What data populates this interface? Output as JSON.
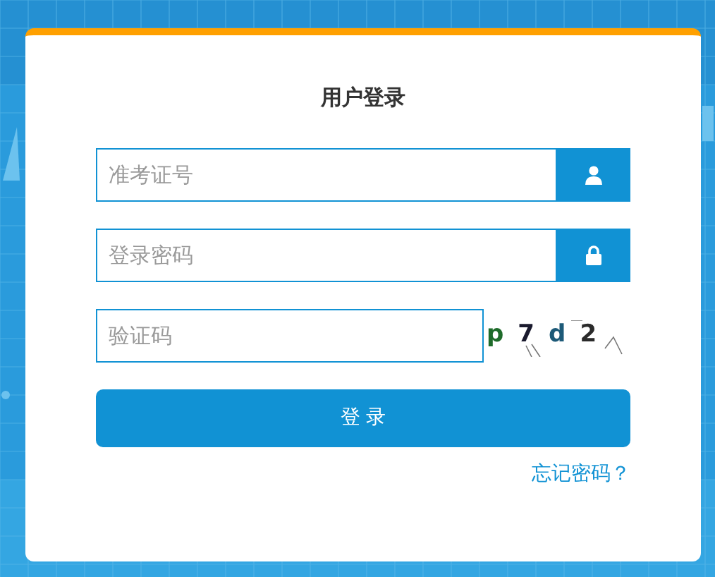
{
  "title": "用户登录",
  "fields": [
    {
      "placeholder": "准考证号",
      "kind": "user"
    },
    {
      "placeholder": "登录密码",
      "kind": "lock"
    },
    {
      "placeholder": "验证码",
      "kind": "captcha"
    }
  ],
  "captcha": [
    {
      "char": "p",
      "color": "#1e6b2a"
    },
    {
      "char": "7",
      "color": "#1a1a2e"
    },
    {
      "char": "d",
      "color": "#1d5a78"
    },
    {
      "char": "2",
      "color": "#2a2a2a"
    }
  ],
  "login_button": "登 录",
  "forgot_link": "忘记密码？"
}
